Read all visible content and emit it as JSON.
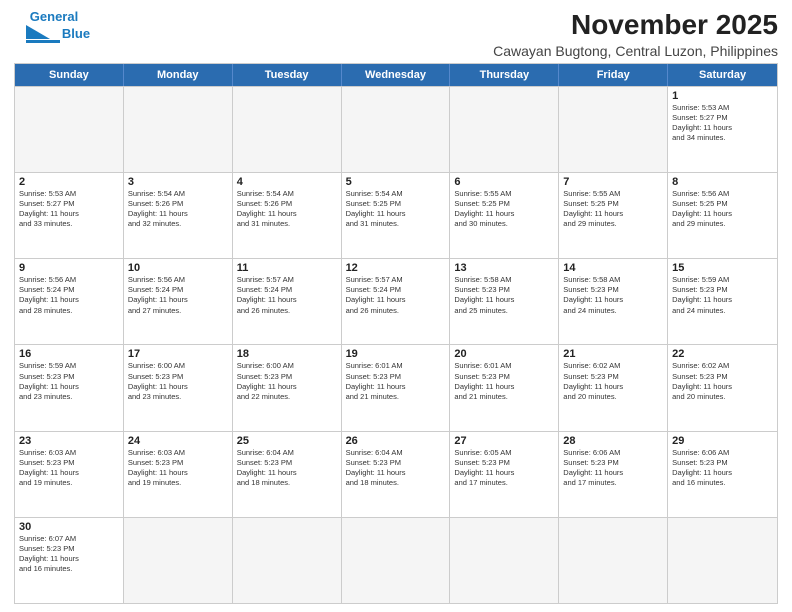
{
  "header": {
    "logo_general": "General",
    "logo_blue": "Blue",
    "main_title": "November 2025",
    "subtitle": "Cawayan Bugtong, Central Luzon, Philippines"
  },
  "days_of_week": [
    "Sunday",
    "Monday",
    "Tuesday",
    "Wednesday",
    "Thursday",
    "Friday",
    "Saturday"
  ],
  "weeks": [
    [
      {
        "day": "",
        "info": ""
      },
      {
        "day": "",
        "info": ""
      },
      {
        "day": "",
        "info": ""
      },
      {
        "day": "",
        "info": ""
      },
      {
        "day": "",
        "info": ""
      },
      {
        "day": "",
        "info": ""
      },
      {
        "day": "1",
        "info": "Sunrise: 5:53 AM\nSunset: 5:27 PM\nDaylight: 11 hours\nand 34 minutes."
      }
    ],
    [
      {
        "day": "2",
        "info": "Sunrise: 5:53 AM\nSunset: 5:27 PM\nDaylight: 11 hours\nand 33 minutes."
      },
      {
        "day": "3",
        "info": "Sunrise: 5:54 AM\nSunset: 5:26 PM\nDaylight: 11 hours\nand 32 minutes."
      },
      {
        "day": "4",
        "info": "Sunrise: 5:54 AM\nSunset: 5:26 PM\nDaylight: 11 hours\nand 31 minutes."
      },
      {
        "day": "5",
        "info": "Sunrise: 5:54 AM\nSunset: 5:25 PM\nDaylight: 11 hours\nand 31 minutes."
      },
      {
        "day": "6",
        "info": "Sunrise: 5:55 AM\nSunset: 5:25 PM\nDaylight: 11 hours\nand 30 minutes."
      },
      {
        "day": "7",
        "info": "Sunrise: 5:55 AM\nSunset: 5:25 PM\nDaylight: 11 hours\nand 29 minutes."
      },
      {
        "day": "8",
        "info": "Sunrise: 5:56 AM\nSunset: 5:25 PM\nDaylight: 11 hours\nand 29 minutes."
      }
    ],
    [
      {
        "day": "9",
        "info": "Sunrise: 5:56 AM\nSunset: 5:24 PM\nDaylight: 11 hours\nand 28 minutes."
      },
      {
        "day": "10",
        "info": "Sunrise: 5:56 AM\nSunset: 5:24 PM\nDaylight: 11 hours\nand 27 minutes."
      },
      {
        "day": "11",
        "info": "Sunrise: 5:57 AM\nSunset: 5:24 PM\nDaylight: 11 hours\nand 26 minutes."
      },
      {
        "day": "12",
        "info": "Sunrise: 5:57 AM\nSunset: 5:24 PM\nDaylight: 11 hours\nand 26 minutes."
      },
      {
        "day": "13",
        "info": "Sunrise: 5:58 AM\nSunset: 5:23 PM\nDaylight: 11 hours\nand 25 minutes."
      },
      {
        "day": "14",
        "info": "Sunrise: 5:58 AM\nSunset: 5:23 PM\nDaylight: 11 hours\nand 24 minutes."
      },
      {
        "day": "15",
        "info": "Sunrise: 5:59 AM\nSunset: 5:23 PM\nDaylight: 11 hours\nand 24 minutes."
      }
    ],
    [
      {
        "day": "16",
        "info": "Sunrise: 5:59 AM\nSunset: 5:23 PM\nDaylight: 11 hours\nand 23 minutes."
      },
      {
        "day": "17",
        "info": "Sunrise: 6:00 AM\nSunset: 5:23 PM\nDaylight: 11 hours\nand 23 minutes."
      },
      {
        "day": "18",
        "info": "Sunrise: 6:00 AM\nSunset: 5:23 PM\nDaylight: 11 hours\nand 22 minutes."
      },
      {
        "day": "19",
        "info": "Sunrise: 6:01 AM\nSunset: 5:23 PM\nDaylight: 11 hours\nand 21 minutes."
      },
      {
        "day": "20",
        "info": "Sunrise: 6:01 AM\nSunset: 5:23 PM\nDaylight: 11 hours\nand 21 minutes."
      },
      {
        "day": "21",
        "info": "Sunrise: 6:02 AM\nSunset: 5:23 PM\nDaylight: 11 hours\nand 20 minutes."
      },
      {
        "day": "22",
        "info": "Sunrise: 6:02 AM\nSunset: 5:23 PM\nDaylight: 11 hours\nand 20 minutes."
      }
    ],
    [
      {
        "day": "23",
        "info": "Sunrise: 6:03 AM\nSunset: 5:23 PM\nDaylight: 11 hours\nand 19 minutes."
      },
      {
        "day": "24",
        "info": "Sunrise: 6:03 AM\nSunset: 5:23 PM\nDaylight: 11 hours\nand 19 minutes."
      },
      {
        "day": "25",
        "info": "Sunrise: 6:04 AM\nSunset: 5:23 PM\nDaylight: 11 hours\nand 18 minutes."
      },
      {
        "day": "26",
        "info": "Sunrise: 6:04 AM\nSunset: 5:23 PM\nDaylight: 11 hours\nand 18 minutes."
      },
      {
        "day": "27",
        "info": "Sunrise: 6:05 AM\nSunset: 5:23 PM\nDaylight: 11 hours\nand 17 minutes."
      },
      {
        "day": "28",
        "info": "Sunrise: 6:06 AM\nSunset: 5:23 PM\nDaylight: 11 hours\nand 17 minutes."
      },
      {
        "day": "29",
        "info": "Sunrise: 6:06 AM\nSunset: 5:23 PM\nDaylight: 11 hours\nand 16 minutes."
      }
    ],
    [
      {
        "day": "30",
        "info": "Sunrise: 6:07 AM\nSunset: 5:23 PM\nDaylight: 11 hours\nand 16 minutes."
      },
      {
        "day": "",
        "info": ""
      },
      {
        "day": "",
        "info": ""
      },
      {
        "day": "",
        "info": ""
      },
      {
        "day": "",
        "info": ""
      },
      {
        "day": "",
        "info": ""
      },
      {
        "day": "",
        "info": ""
      }
    ]
  ]
}
